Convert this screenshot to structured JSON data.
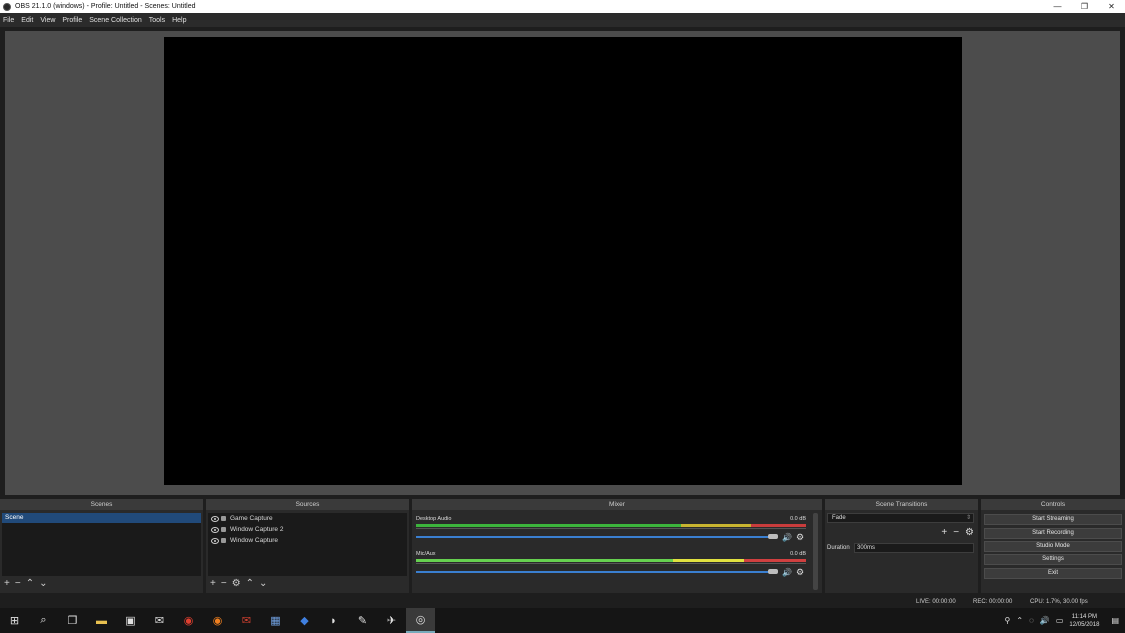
{
  "window": {
    "title": "OBS 21.1.0 (windows) - Profile: Untitled - Scenes: Untitled",
    "min": "—",
    "max": "❐",
    "close": "✕"
  },
  "menu": [
    "File",
    "Edit",
    "View",
    "Profile",
    "Scene Collection",
    "Tools",
    "Help"
  ],
  "panels": {
    "scenes": {
      "title": "Scenes",
      "items": [
        "Scene"
      ]
    },
    "sources": {
      "title": "Sources",
      "items": [
        "Game Capture",
        "Window Capture 2",
        "Window Capture"
      ]
    },
    "mixer": {
      "title": "Mixer",
      "tracks": [
        {
          "name": "Desktop Audio",
          "db": "0.0 dB"
        },
        {
          "name": "Mic/Aux",
          "db": "0.0 dB"
        }
      ]
    },
    "transitions": {
      "title": "Scene Transitions",
      "selected": "Fade",
      "duration_label": "Duration",
      "duration_value": "300ms"
    },
    "controls": {
      "title": "Controls",
      "buttons": [
        "Start Streaming",
        "Start Recording",
        "Studio Mode",
        "Settings",
        "Exit"
      ]
    }
  },
  "status": {
    "live": "LIVE: 00:00:00",
    "rec": "REC: 00:00:00",
    "cpu": "CPU: 1.7%, 30.00 fps"
  },
  "taskbar": {
    "time": "11:14 PM",
    "date": "12/05/2018"
  },
  "colors": {
    "meter_green": "#3cb43c",
    "meter_yellow": "#c8b430",
    "meter_red": "#c83c3c",
    "slider_blue": "#3a7fd0",
    "selected_scene": "#214a7a"
  }
}
